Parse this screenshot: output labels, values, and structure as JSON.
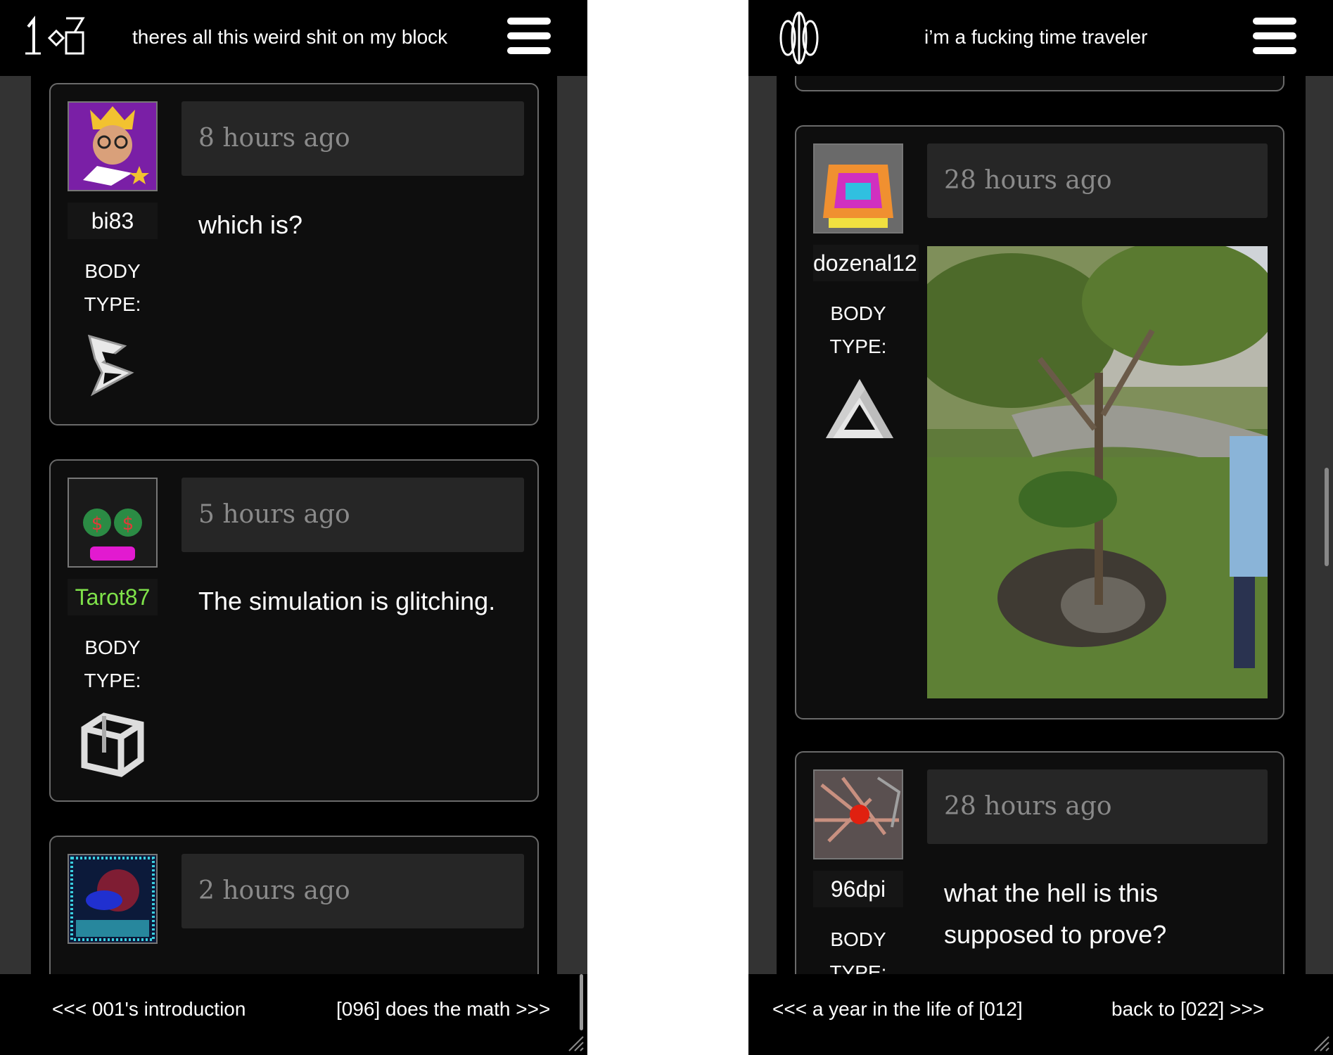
{
  "left": {
    "header": {
      "title": "theres all this weird shit on my block",
      "logo": "108-glyph-logo",
      "menu_icon": "hamburger-menu-icon"
    },
    "posts": [
      {
        "time": "8 hours ago",
        "username": "bi83",
        "body_type_label": "BODY TYPE:",
        "body_type_icon": "impossible-b-icon",
        "message": "which is?"
      },
      {
        "time": "5 hours ago",
        "username": "Tarot87",
        "body_type_label": "BODY TYPE:",
        "body_type_icon": "impossible-cube-icon",
        "message": "The simulation is glitching."
      },
      {
        "time": "2 hours ago",
        "username": "",
        "message": ""
      }
    ],
    "footer": {
      "prev": "<<< 001's introduction",
      "next": "[096] does the math >>>"
    }
  },
  "right": {
    "header": {
      "title": "i’m a fucking time traveler",
      "logo": "ring-glyph-logo",
      "menu_icon": "hamburger-menu-icon"
    },
    "posts": [
      {
        "time": "28 hours ago",
        "username": "dozenal12",
        "body_type_label": "BODY TYPE:",
        "body_type_icon": "penrose-triangle-icon",
        "image": "tree-garden-photo"
      },
      {
        "time": "28 hours ago",
        "username": "96dpi",
        "body_type_label": "BODY TYPE:",
        "message": "what the hell is this supposed to prove?"
      }
    ],
    "footer": {
      "prev": "<<< a year in the life of [012]",
      "next": "back to [022] >>>"
    }
  }
}
